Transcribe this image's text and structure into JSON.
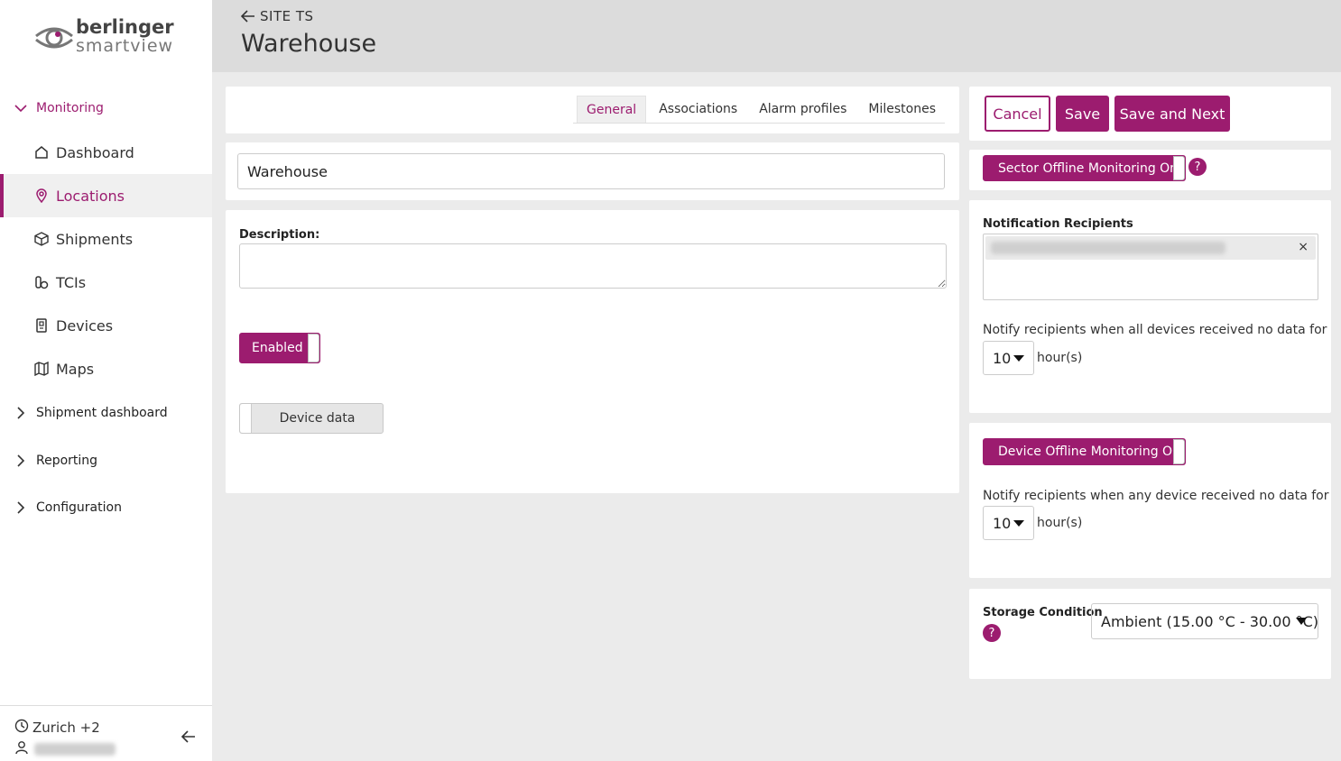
{
  "colors": {
    "accent": "#9c1c6f",
    "header_bg": "#dcdcdc",
    "page_bg": "#ebebeb"
  },
  "logo": {
    "line1": "berlinger",
    "line2": "smartview"
  },
  "sidebar": {
    "monitoring_label": "Monitoring",
    "items": [
      {
        "label": "Dashboard",
        "icon": "home-icon"
      },
      {
        "label": "Locations",
        "icon": "location-pin-icon"
      },
      {
        "label": "Shipments",
        "icon": "package-icon"
      },
      {
        "label": "TCIs",
        "icon": "tci-icon"
      },
      {
        "label": "Devices",
        "icon": "device-icon"
      },
      {
        "label": "Maps",
        "icon": "map-icon"
      }
    ],
    "groups": [
      {
        "label": "Shipment dashboard"
      },
      {
        "label": "Reporting"
      },
      {
        "label": "Configuration"
      }
    ],
    "footer": {
      "timezone": "Zurich +2"
    }
  },
  "header": {
    "back_label": "SITE TS",
    "title": "Warehouse"
  },
  "tabs": [
    {
      "label": "General"
    },
    {
      "label": "Associations"
    },
    {
      "label": "Alarm profiles"
    },
    {
      "label": "Milestones"
    }
  ],
  "form": {
    "name_value": "Warehouse",
    "description_label": "Description:",
    "enabled_label": "Enabled",
    "device_data_label": "Device data"
  },
  "actions": {
    "cancel": "Cancel",
    "save": "Save",
    "save_next": "Save and Next"
  },
  "sector": {
    "toggle_label": "Sector Offline Monitoring On",
    "help": "?",
    "recipients_label": "Notification Recipients",
    "remove": "×",
    "notify_text": "Notify recipients when all devices received no data for",
    "hours_value": "10",
    "hours_unit": "hour(s)"
  },
  "device": {
    "toggle_label": "Device Offline Monitoring On",
    "notify_text": "Notify recipients when any device received no data for",
    "hours_value": "10",
    "hours_unit": "hour(s)"
  },
  "storage": {
    "label": "Storage Condition",
    "help": "?",
    "value": "Ambient (15.00 °C - 30.00 °C)"
  }
}
